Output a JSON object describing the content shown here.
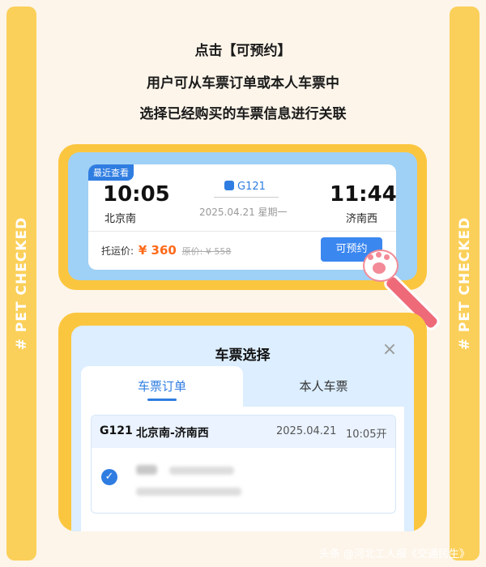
{
  "sidebar": {
    "text": "# PET CHECKED"
  },
  "instruction": {
    "line1": "点击【可预约】",
    "line2": "用户可从车票订单或本人车票中",
    "line3": "选择已经购买的车票信息进行关联"
  },
  "ticket_card": {
    "tag": "最近查看",
    "depart_time": "10:05",
    "depart_station": "北京南",
    "train_no": "G121",
    "date": "2025.04.21 星期一",
    "arrive_time": "11:44",
    "arrive_station": "济南西",
    "price_label": "托运价:",
    "price": "¥ 360",
    "original_price": "原价: ¥ 558",
    "book_button": "可预约"
  },
  "ticket_sheet": {
    "title": "车票选择",
    "close_icon": "close-icon",
    "tabs": [
      "车票订单",
      "本人车票"
    ],
    "active_tab": 0,
    "order": {
      "train_no": "G121",
      "route": "北京南-济南西",
      "date": "2025.04.21",
      "time": "10:05开"
    }
  },
  "footer": {
    "text": "头条 @河北工人报《交通民生》"
  },
  "colors": {
    "frame": "#fbc63f",
    "side": "#fbd05a",
    "accent_blue": "#2f7de1",
    "price_orange": "#ff6a1a",
    "background": "#fdf5ea"
  }
}
